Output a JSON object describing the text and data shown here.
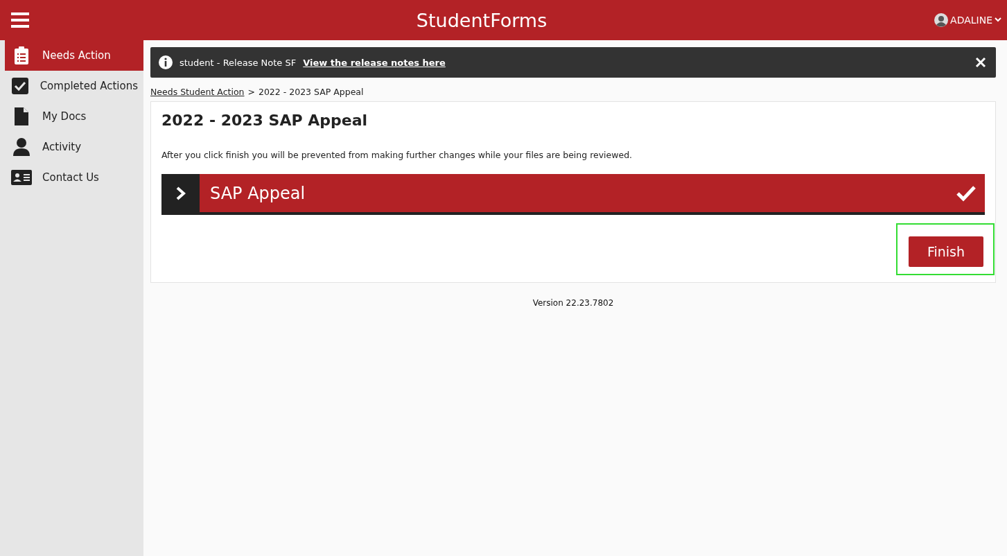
{
  "header": {
    "title": "StudentForms",
    "user": "ADALINE"
  },
  "sidebar": {
    "items": [
      {
        "label": "Needs Action",
        "selected": true
      },
      {
        "label": "Completed Actions",
        "selected": false
      },
      {
        "label": "My Docs",
        "selected": false
      },
      {
        "label": "Activity",
        "selected": false
      },
      {
        "label": "Contact Us",
        "selected": false
      }
    ]
  },
  "notice": {
    "text": "student - Release Note SF",
    "link": "View the release notes here"
  },
  "breadcrumb": {
    "link": "Needs Student Action",
    "separator": ">",
    "current": "2022 - 2023 SAP Appeal"
  },
  "form": {
    "title": "2022 - 2023 SAP Appeal",
    "instructions": "After you click finish you will be prevented from making further changes while your files are being reviewed.",
    "sections": [
      {
        "title": "SAP Appeal",
        "expanded": false,
        "complete": true
      }
    ],
    "finish_button": {
      "label": "Finish",
      "highlighted": true
    }
  },
  "version": "Version 22.23.7802"
}
